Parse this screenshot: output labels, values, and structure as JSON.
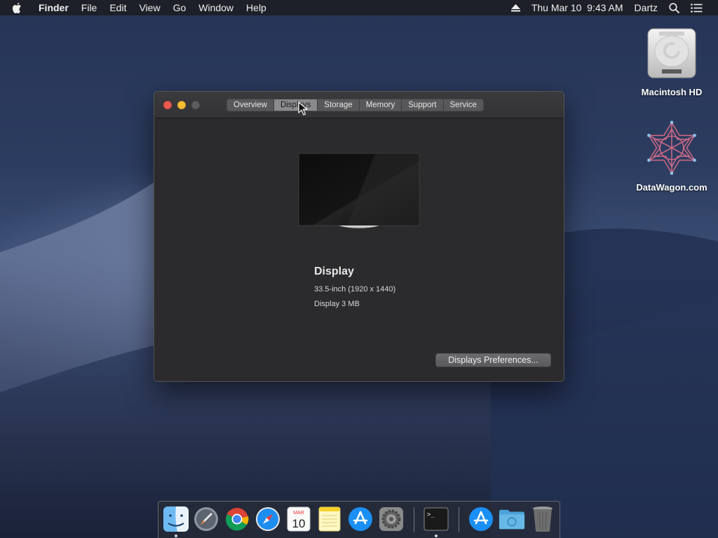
{
  "menubar": {
    "app_name": "Finder",
    "items": [
      "File",
      "Edit",
      "View",
      "Go",
      "Window",
      "Help"
    ],
    "clock": "Thu Mar 10  9:43 AM",
    "user": "Dartz"
  },
  "desktop": {
    "icons": [
      {
        "label": "Macintosh HD",
        "icon": "hard-drive-icon"
      },
      {
        "label": "DataWagon.com",
        "icon": "datawagon-logo-icon"
      }
    ]
  },
  "window": {
    "tabs": [
      "Overview",
      "Displays",
      "Storage",
      "Memory",
      "Support",
      "Service"
    ],
    "active_tab": "Displays",
    "display": {
      "title": "Display",
      "size": "33.5-inch (1920 x 1440)",
      "memory": "Display 3 MB"
    },
    "preferences_button": "Displays Preferences..."
  },
  "dock": {
    "items": [
      {
        "name": "finder",
        "icon": "finder-icon",
        "running": true
      },
      {
        "name": "launchpad",
        "icon": "launchpad-icon",
        "running": false
      },
      {
        "name": "chrome",
        "icon": "chrome-icon",
        "running": false
      },
      {
        "name": "safari",
        "icon": "safari-icon",
        "running": false
      },
      {
        "name": "calendar",
        "icon": "calendar-icon",
        "running": false,
        "month": "MAR",
        "day": "10"
      },
      {
        "name": "notes",
        "icon": "notes-icon",
        "running": false
      },
      {
        "name": "app-store",
        "icon": "app-store-icon",
        "running": false
      },
      {
        "name": "system-preferences",
        "icon": "gear-icon",
        "running": false
      },
      {
        "name": "terminal",
        "icon": "terminal-icon",
        "running": true
      },
      {
        "name": "applications",
        "icon": "app-store-icon",
        "running": false
      },
      {
        "name": "downloads",
        "icon": "folder-icon",
        "running": false
      },
      {
        "name": "trash",
        "icon": "trash-icon",
        "running": false
      }
    ]
  },
  "colors": {
    "close": "#ee5a52",
    "minimize": "#f5bd30",
    "window_bg": "#2b2b2d"
  }
}
